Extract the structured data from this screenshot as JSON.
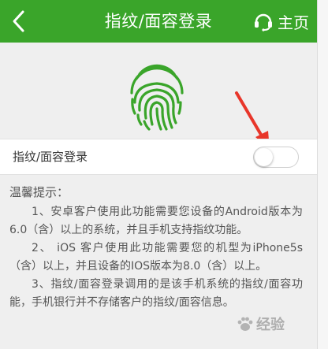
{
  "header": {
    "title": "指纹/面容登录",
    "home_label": "主页"
  },
  "setting": {
    "label": "指纹/面容登录",
    "enabled": false
  },
  "tips": {
    "title": "温馨提示：",
    "items": [
      "1、安卓客户使用此功能需要您设备的Android版本为6.0（含）以上的系统，并且手机支持指纹功能。",
      "2、 iOS 客户使用此功能需要您的机型为iPhone5s（含）以上，并且设备的IOS版本为8.0（含）以上。",
      "3、指纹/面容登录调用的是该手机系统的指纹/面容功能，手机银行并不存储客户的指纹/面容信息。"
    ]
  },
  "watermark": {
    "text": "经验"
  },
  "colors": {
    "header_bg": "#3aa52a",
    "fingerprint": "#3aa52a",
    "arrow": "#e8362a"
  },
  "icons": {
    "back": "chevron-left-icon",
    "home": "headset-icon",
    "fingerprint": "fingerprint-icon",
    "annotation": "red-arrow-icon"
  }
}
